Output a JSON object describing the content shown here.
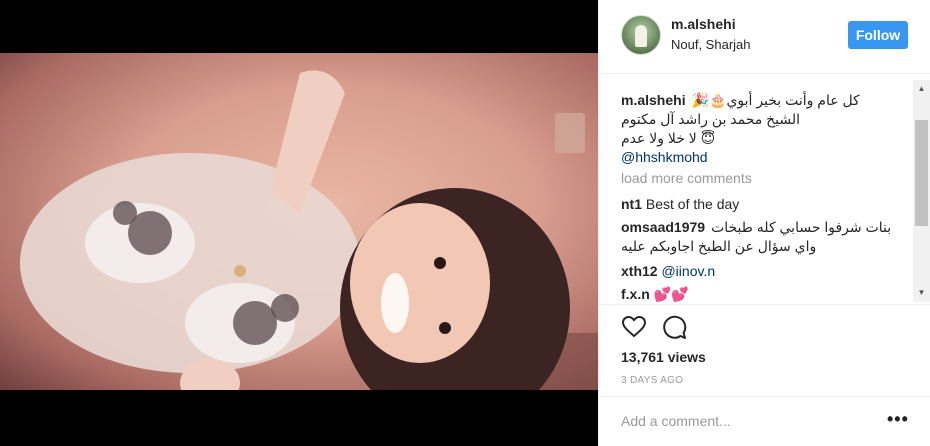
{
  "post": {
    "username": "m.alshehi",
    "location": "Nouf, Sharjah",
    "follow_label": "Follow"
  },
  "caption": {
    "username": "m.alshehi",
    "line1": "كل عام وأنت بخير أبوي🎂🎉",
    "line2": "الشيخ محمد بن راشد آل مكتوم",
    "line3": "لا خلا ولا عدم 😇",
    "mention": "@hhshkmohd"
  },
  "load_more": "load more comments",
  "comments": [
    {
      "user": "nt1",
      "text": "Best of the day"
    },
    {
      "user": "omsaad1979",
      "text": "بنات شرفوا حسابي كله طبخات",
      "text2": "واي سؤال عن الطبخ اجاوبكم عليه"
    },
    {
      "user": "xth12",
      "text": "@iinov.n"
    },
    {
      "user": "f.x.n",
      "text": "💕💕"
    }
  ],
  "stats": {
    "views": "13,761 views",
    "date": "3 DAYS AGO"
  },
  "add_comment": {
    "placeholder": "Add a comment...",
    "more_label": "•••"
  },
  "icons": [
    "heart-icon",
    "comment-icon",
    "more-options-icon",
    "scroll-up-arrow",
    "scroll-down-arrow"
  ],
  "colors": {
    "follow": "#3897f0",
    "mention": "#003569",
    "muted": "#999999"
  }
}
